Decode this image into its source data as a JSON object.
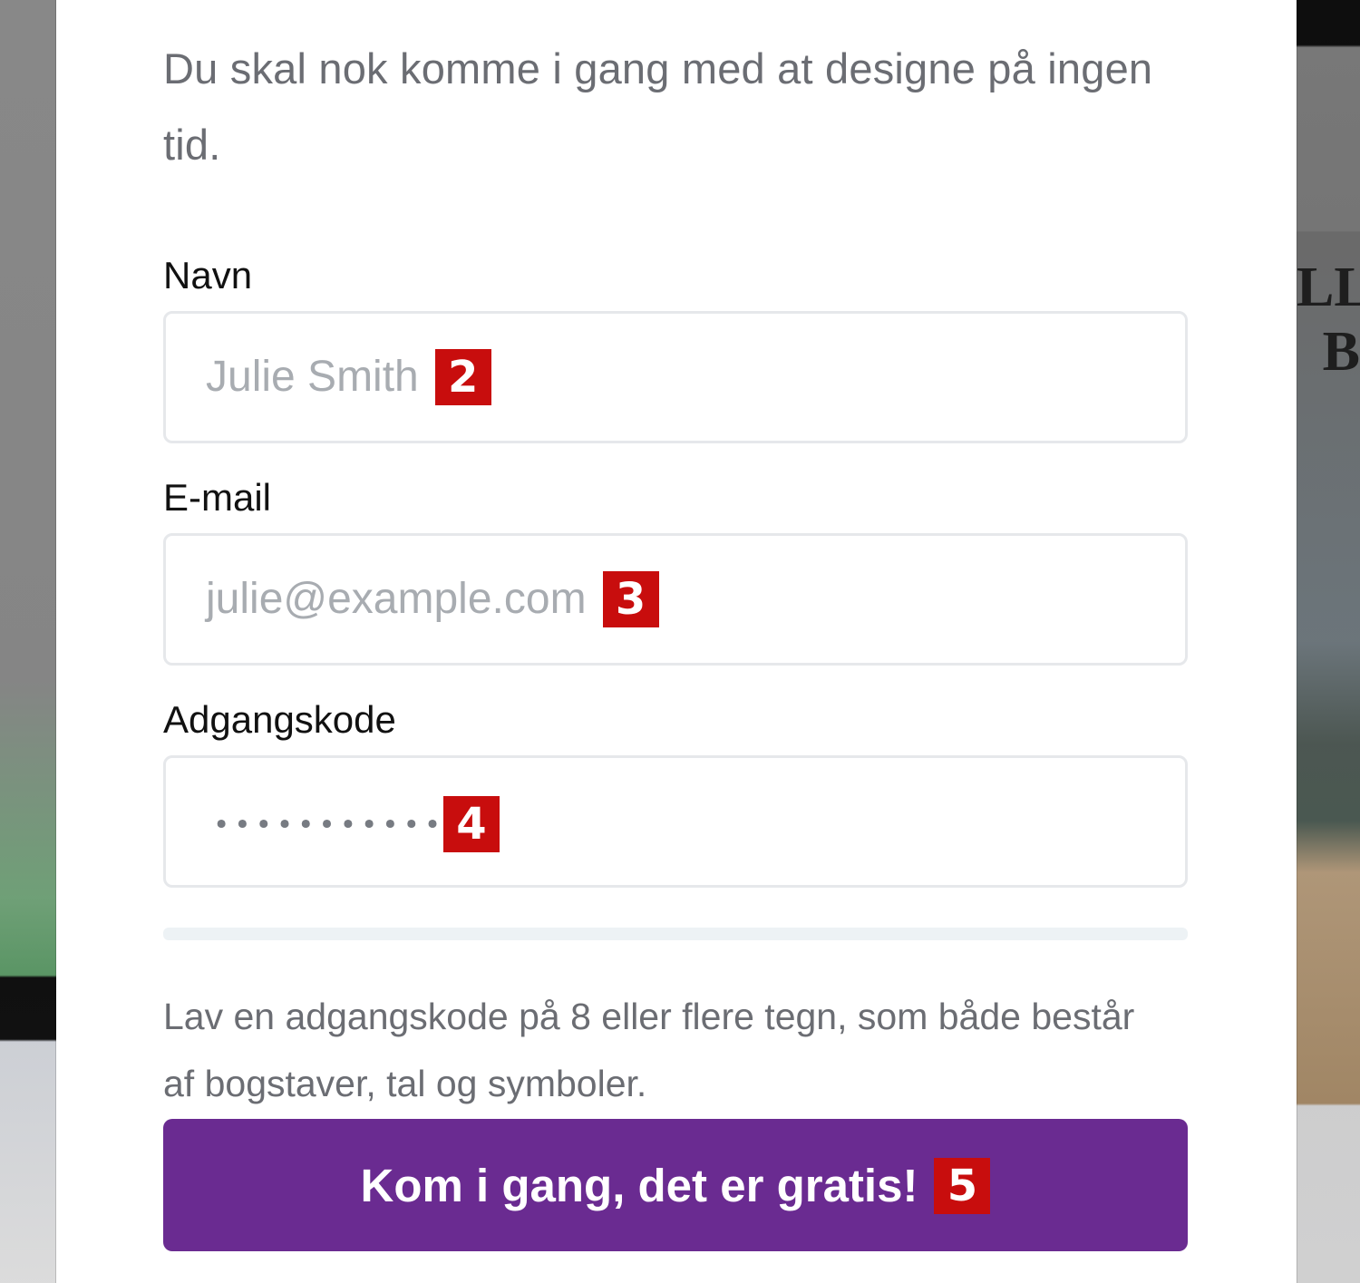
{
  "modal": {
    "intro_text": "Du skal nok komme i gang med at designe på ingen tid.",
    "fields": [
      {
        "label": "Navn",
        "value": "Julie Smith",
        "marker": "2"
      },
      {
        "label": "E-mail",
        "value": "julie@example.com",
        "marker": "3"
      },
      {
        "label": "Adgangskode",
        "value": "••••••••••••",
        "marker": "4"
      }
    ],
    "help_text": "Lav en adgangskode på 8 eller flere tegn, som både består af bogstaver, tal og symboler.",
    "button_label": "Kom i gang, det er gratis!",
    "button_marker": "5"
  },
  "background": {
    "right_edge_text": "LL\nB"
  },
  "colors": {
    "button": "#6a2b91",
    "marker": "#c80d0d",
    "input_border": "#e6e8eb"
  }
}
